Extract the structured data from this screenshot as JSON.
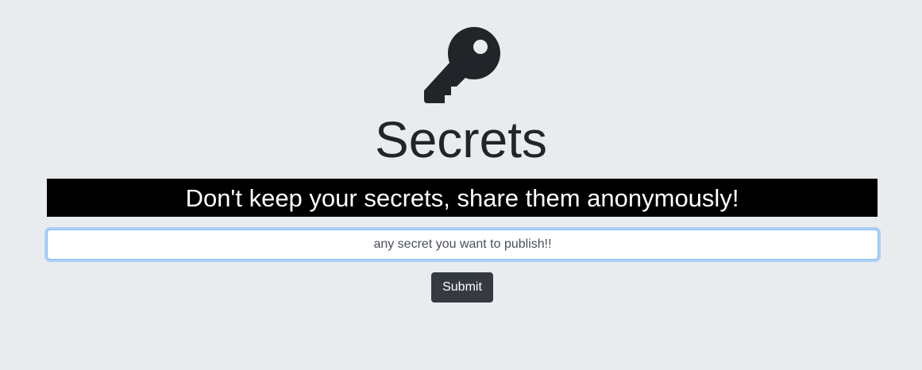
{
  "header": {
    "icon": "key-icon",
    "title": "Secrets"
  },
  "banner": {
    "text": "Don't keep your secrets, share them anonymously!"
  },
  "form": {
    "secret_placeholder": "any secret you want to publish!!",
    "secret_value": "",
    "submit_label": "Submit"
  },
  "colors": {
    "background": "#e9ecef",
    "text": "#212529",
    "banner_background": "#000000",
    "banner_text": "#ffffff",
    "button_background": "#343a40",
    "input_focus_border": "#80bdff"
  }
}
